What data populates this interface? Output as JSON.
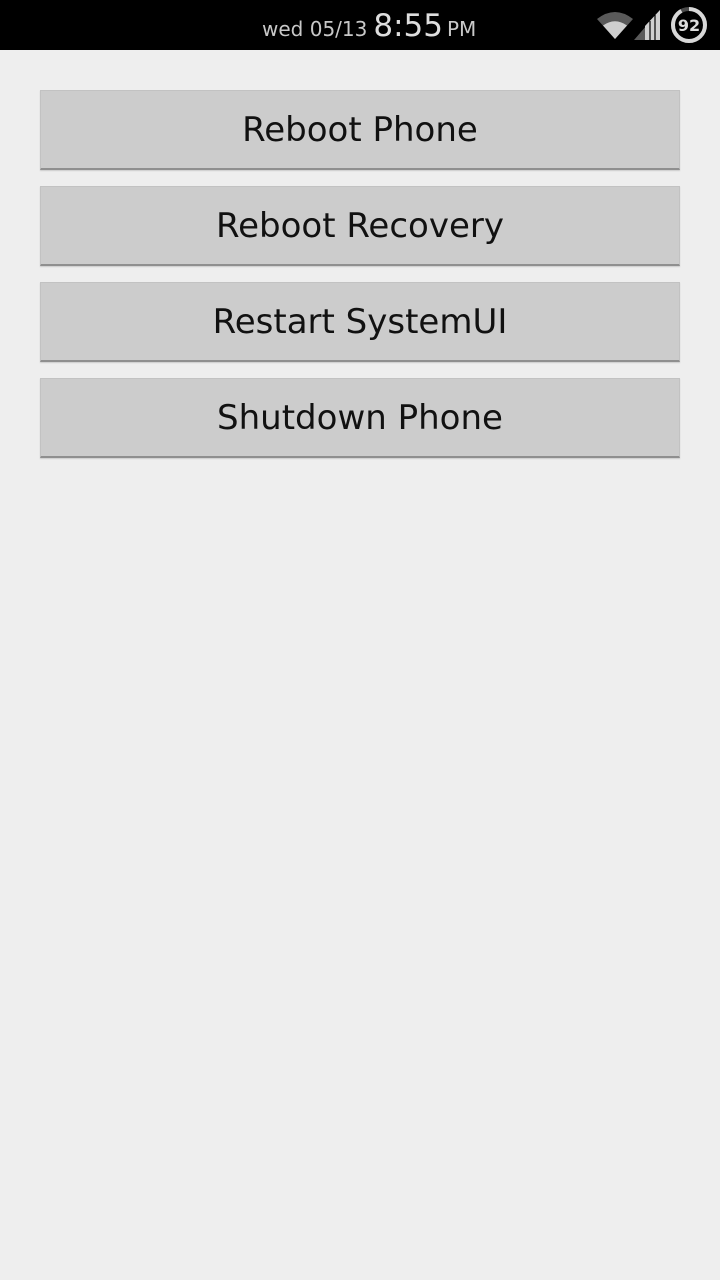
{
  "status_bar": {
    "date": "wed 05/13",
    "time": "8:55",
    "ampm": "PM",
    "battery_level": "92",
    "battery_fraction": 0.92,
    "icons": [
      "wifi-icon",
      "signal-icon",
      "battery-icon"
    ]
  },
  "actions": {
    "reboot_phone": "Reboot Phone",
    "reboot_recovery": "Reboot Recovery",
    "restart_systemui": "Restart SystemUI",
    "shutdown_phone": "Shutdown Phone"
  },
  "colors": {
    "status_bar_bg": "#000000",
    "background": "#eeeeee",
    "button_bg": "#cccccc",
    "button_text": "#111111"
  }
}
